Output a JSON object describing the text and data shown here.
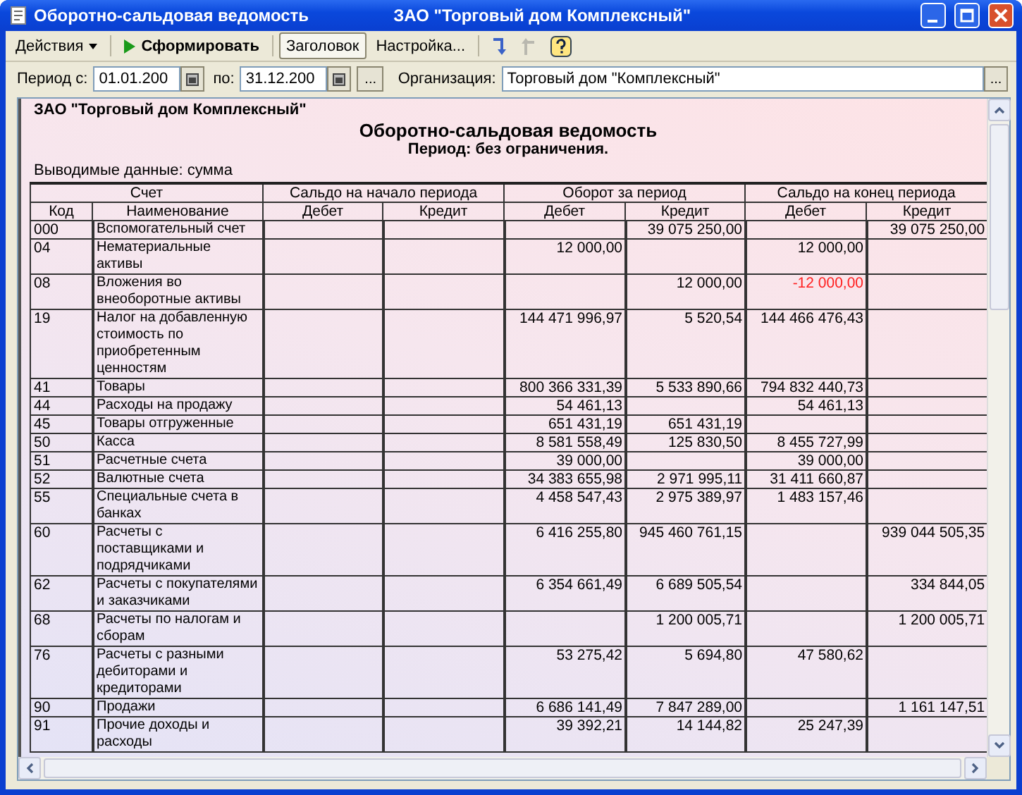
{
  "window": {
    "title": "Оборотно-сальдовая ведомость",
    "subtitle": "ЗАО \"Торговый дом Комплексный\""
  },
  "toolbar": {
    "actions": "Действия",
    "generate": "Сформировать",
    "buttons": [
      {
        "label": "Заголовок",
        "selected": true
      },
      {
        "label": "Настройка...",
        "selected": false
      }
    ]
  },
  "filters": {
    "period_from_label": "Период с:",
    "period_from": "01.01.200",
    "period_to_label": "по:",
    "period_to": "31.12.200",
    "period_button": "...",
    "org_label": "Организация:",
    "org": "Торговый дом \"Комплексный\"",
    "org_button": "..."
  },
  "report": {
    "company": "ЗАО \"Торговый дом Комплексный\"",
    "title": "Оборотно-сальдовая ведомость",
    "period": "Период: без ограничения.",
    "output": "Выводимые данные: сумма",
    "column_groups": [
      "Счет",
      "Сальдо на начало периода",
      "Оборот за период",
      "Сальдо на конец периода"
    ],
    "columns": [
      "Код",
      "Наименование",
      "Дебет",
      "Кредит",
      "Дебет",
      "Кредит",
      "Дебет",
      "Кредит"
    ],
    "rows": [
      {
        "code": "000",
        "name": "Вспомогательный счет",
        "turnover_credit": "39 075 250,00",
        "close_credit": "39 075 250,00"
      },
      {
        "code": "04",
        "name": "Нематериальные\nактивы",
        "turnover_debit": "12 000,00",
        "close_debit": {
          "text": "12 000,00",
          "negative": false
        }
      },
      {
        "code": "08",
        "name": "Вложения во\nвнеоборотные активы",
        "turnover_credit": "12 000,00",
        "close_debit": {
          "text": "-12 000,00",
          "negative": true
        }
      },
      {
        "code": "19",
        "name": "Налог на добавленную\nстоимость по\nприобретенным\nценностям",
        "turnover_debit": "144 471 996,97",
        "turnover_credit": "5 520,54",
        "close_debit": {
          "text": "144 466 476,43",
          "negative": false
        }
      },
      {
        "code": "41",
        "name": "Товары",
        "turnover_debit": "800 366 331,39",
        "turnover_credit": "5 533 890,66",
        "close_debit": {
          "text": "794 832 440,73",
          "negative": false
        }
      },
      {
        "code": "44",
        "name": "Расходы на продажу",
        "turnover_debit": "54 461,13",
        "close_debit": {
          "text": "54 461,13",
          "negative": false
        }
      },
      {
        "code": "45",
        "name": "Товары отгруженные",
        "turnover_debit": "651 431,19",
        "turnover_credit": "651 431,19"
      },
      {
        "code": "50",
        "name": "Касса",
        "turnover_debit": "8 581 558,49",
        "turnover_credit": "125 830,50",
        "close_debit": {
          "text": "8 455 727,99",
          "negative": false
        }
      },
      {
        "code": "51",
        "name": "Расчетные счета",
        "turnover_debit": "39 000,00",
        "close_debit": {
          "text": "39 000,00",
          "negative": false
        }
      },
      {
        "code": "52",
        "name": "Валютные счета",
        "turnover_debit": "34 383 655,98",
        "turnover_credit": "2 971 995,11",
        "close_debit": {
          "text": "31 411 660,87",
          "negative": false
        }
      },
      {
        "code": "55",
        "name": "Специальные счета в\nбанках",
        "turnover_debit": "4 458 547,43",
        "turnover_credit": "2 975 389,97",
        "close_debit": {
          "text": "1 483 157,46",
          "negative": false
        }
      },
      {
        "code": "60",
        "name": "Расчеты с\nпоставщиками и\nподрядчиками",
        "turnover_debit": "6 416 255,80",
        "turnover_credit": "945 460 761,15",
        "close_credit": "939 044 505,35"
      },
      {
        "code": "62",
        "name": "Расчеты с покупателями\nи заказчиками",
        "turnover_debit": "6 354 661,49",
        "turnover_credit": "6 689 505,54",
        "close_credit": "334 844,05"
      },
      {
        "code": "68",
        "name": "Расчеты по налогам и\nсборам",
        "turnover_credit": "1 200 005,71",
        "close_credit": "1 200 005,71"
      },
      {
        "code": "76",
        "name": "Расчеты с разными\nдебиторами и\nкредиторами",
        "turnover_debit": "53 275,42",
        "turnover_credit": "5 694,80",
        "close_debit": {
          "text": "47 580,62",
          "negative": false
        }
      },
      {
        "code": "90",
        "name": "Продажи",
        "turnover_debit": "6 686 141,49",
        "turnover_credit": "7 847 289,00",
        "close_credit": "1 161 147,51"
      },
      {
        "code": "91",
        "name": "Прочие доходы и\nрасходы",
        "turnover_debit": "39 392,21",
        "turnover_credit": "14 144,82",
        "close_debit": {
          "text": "25 247,39",
          "negative": false
        }
      }
    ]
  }
}
